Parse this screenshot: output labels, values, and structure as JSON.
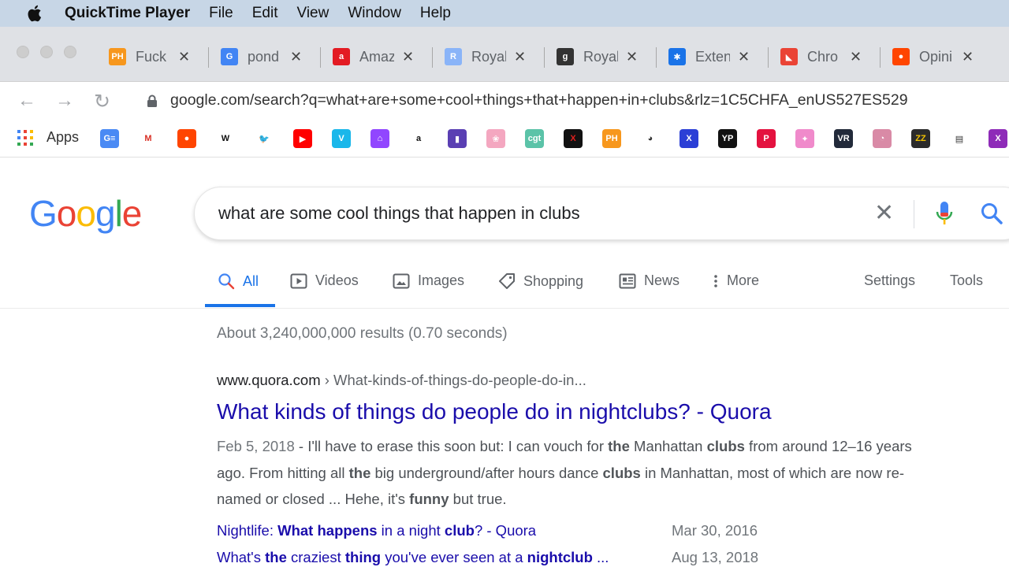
{
  "menubar": {
    "app_name": "QuickTime Player",
    "items": [
      "File",
      "Edit",
      "View",
      "Window",
      "Help"
    ]
  },
  "tabs": [
    {
      "label": "Fuck",
      "favicon": "PH",
      "favicon_color": "#f7971d",
      "icon": "ph-favicon"
    },
    {
      "label": "pond",
      "favicon": "G",
      "favicon_color": "#4285f4",
      "icon": "google-favicon"
    },
    {
      "label": "Amaz",
      "favicon": "a",
      "favicon_color": "#e31b23",
      "icon": "amaz-favicon"
    },
    {
      "label": "Royal",
      "favicon": "R",
      "favicon_color": "#8ab4f8",
      "icon": "royal-favicon"
    },
    {
      "label": "Royal",
      "favicon": "g",
      "favicon_color": "#333333",
      "icon": "genius-favicon"
    },
    {
      "label": "Exten",
      "favicon": "✱",
      "favicon_color": "#1a73e8",
      "icon": "extension-favicon"
    },
    {
      "label": "Chro",
      "favicon": "◣",
      "favicon_color": "#ea4335",
      "icon": "chrome-store-favicon"
    },
    {
      "label": "Opini",
      "favicon": "●",
      "favicon_color": "#ff4500",
      "icon": "reddit-favicon"
    }
  ],
  "address": {
    "url": "google.com/search?q=what+are+some+cool+things+that+happen+in+clubs&rlz=1C5CHFA_enUS527ES529"
  },
  "bookmarks": {
    "apps_label": "Apps",
    "icons": [
      {
        "name": "gsuite-bookmark",
        "glyph": "G≡",
        "color": "#4a8af4"
      },
      {
        "name": "gmail-bookmark",
        "glyph": "M",
        "color": "#ffffff",
        "fg": "#d93025"
      },
      {
        "name": "reddit-bookmark",
        "glyph": "●",
        "color": "#ff4500"
      },
      {
        "name": "wikipedia-bookmark",
        "glyph": "W",
        "color": "#ffffff",
        "fg": "#111111"
      },
      {
        "name": "twitter-bookmark",
        "glyph": "🐦",
        "color": "#ffffff",
        "fg": "#1da1f2"
      },
      {
        "name": "youtube-bookmark",
        "glyph": "▶",
        "color": "#ff0000"
      },
      {
        "name": "vimeo-bookmark",
        "glyph": "V",
        "color": "#1ab7ea"
      },
      {
        "name": "twitch-bookmark",
        "glyph": "⌂",
        "color": "#9146ff"
      },
      {
        "name": "amazon-bookmark",
        "glyph": "a",
        "color": "#ffffff",
        "fg": "#111111"
      },
      {
        "name": "shop-bookmark",
        "glyph": "▮",
        "color": "#5a3fb3"
      },
      {
        "name": "pink-bookmark",
        "glyph": "❀",
        "color": "#f4a7c0"
      },
      {
        "name": "cgt-bookmark",
        "glyph": "cgt",
        "color": "#5bc3a8"
      },
      {
        "name": "x-red-bookmark",
        "glyph": "X",
        "color": "#111111",
        "fg": "#e0201e"
      },
      {
        "name": "ph-bookmark",
        "glyph": "PH",
        "color": "#f7971d"
      },
      {
        "name": "panda-bookmark",
        "glyph": "◕",
        "color": "#ffffff",
        "fg": "#333333"
      },
      {
        "name": "x-blue-bookmark",
        "glyph": "X",
        "color": "#2b3fd6"
      },
      {
        "name": "yp-bookmark",
        "glyph": "YP",
        "color": "#111111"
      },
      {
        "name": "p-bookmark",
        "glyph": "P",
        "color": "#e4123f"
      },
      {
        "name": "unicorn-bookmark",
        "glyph": "✦",
        "color": "#f08acb"
      },
      {
        "name": "vr-bookmark",
        "glyph": "VR",
        "color": "#222a3a"
      },
      {
        "name": "face-bookmark",
        "glyph": "◔",
        "color": "#d98aa6"
      },
      {
        "name": "zz-bookmark",
        "glyph": "ZZ",
        "color": "#2b2b2b",
        "fg": "#f2c200"
      },
      {
        "name": "bus-bookmark",
        "glyph": "▤",
        "color": "#ffffff",
        "fg": "#333333"
      },
      {
        "name": "x-purple-bookmark",
        "glyph": "X",
        "color": "#8e2bb8"
      }
    ]
  },
  "search": {
    "logo": [
      "G",
      "o",
      "o",
      "g",
      "l",
      "e"
    ],
    "logo_colors": [
      "#4285f4",
      "#ea4335",
      "#fbbc05",
      "#4285f4",
      "#34a853",
      "#ea4335"
    ],
    "query": "what are some cool things that happen in clubs"
  },
  "result_tabs": {
    "items": [
      {
        "label": "All",
        "icon": "search-icon",
        "active": true
      },
      {
        "label": "Videos",
        "icon": "video-icon",
        "active": false
      },
      {
        "label": "Images",
        "icon": "image-icon",
        "active": false
      },
      {
        "label": "Shopping",
        "icon": "tag-icon",
        "active": false
      },
      {
        "label": "News",
        "icon": "newspaper-icon",
        "active": false
      },
      {
        "label": "More",
        "icon": "more-vertical-icon",
        "active": false
      }
    ],
    "settings": "Settings",
    "tools": "Tools"
  },
  "results": {
    "stats": "About 3,240,000,000 results (0.70 seconds)",
    "first": {
      "cite_domain": "www.quora.com",
      "cite_path": " › What-kinds-of-things-do-people-do-in...",
      "title": "What kinds of things do people do in nightclubs? - Quora",
      "date": "Feb 5, 2018",
      "snippet_parts": [
        {
          "t": " - I'll have to erase this soon but: I can vouch for ",
          "b": false
        },
        {
          "t": "the",
          "b": true
        },
        {
          "t": " Manhattan ",
          "b": false
        },
        {
          "t": "clubs",
          "b": true
        },
        {
          "t": " from around 12–16 years ago. From hitting all ",
          "b": false
        },
        {
          "t": "the",
          "b": true
        },
        {
          "t": " big underground/after hours dance ",
          "b": false
        },
        {
          "t": "clubs",
          "b": true
        },
        {
          "t": " in Manhattan, most of which are now re-named or closed ... Hehe, it's ",
          "b": false
        },
        {
          "t": "funny",
          "b": true
        },
        {
          "t": " but true.",
          "b": false
        }
      ],
      "related": [
        {
          "parts": [
            {
              "t": "Nightlife: ",
              "b": false
            },
            {
              "t": "What happens",
              "b": true
            },
            {
              "t": " in a night ",
              "b": false
            },
            {
              "t": "club",
              "b": true
            },
            {
              "t": "? - Quora",
              "b": false
            }
          ],
          "date": "Mar 30, 2016"
        },
        {
          "parts": [
            {
              "t": "What's ",
              "b": false
            },
            {
              "t": "the",
              "b": true
            },
            {
              "t": " craziest ",
              "b": false
            },
            {
              "t": "thing",
              "b": true
            },
            {
              "t": " you've ever seen at a ",
              "b": false
            },
            {
              "t": "nightclub",
              "b": true
            },
            {
              "t": " ...",
              "b": false
            }
          ],
          "date": "Aug 13, 2018"
        }
      ]
    }
  }
}
